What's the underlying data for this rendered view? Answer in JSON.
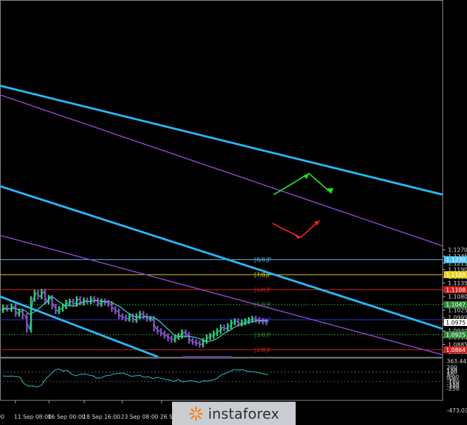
{
  "chart_data": {
    "type": "line",
    "price_panel": {
      "y_range": [
        1.0835,
        1.2285
      ],
      "y_ticks": [
        "1.1270",
        "1.1245",
        "1.1215",
        "1.1190",
        "1.1160",
        "1.1135",
        "1.1105",
        "1.1080",
        "1.1050",
        "1.1025",
        "1.0995",
        "1.0970",
        "1.0940",
        "1.0915",
        "1.0885",
        "1.0855"
      ],
      "current_price": "1.0975",
      "murray_levels": [
        {
          "label": "[8/8]P",
          "value": 1.123,
          "price_tag": "1.1230",
          "color": "#4fc3f7",
          "style": "solid"
        },
        {
          "label": "[7/8]P",
          "value": 1.1169,
          "price_tag": "1.1169",
          "color": "#e6d21e",
          "style": "solid"
        },
        {
          "label": "[6/8]P",
          "value": 1.1108,
          "price_tag": "1.1108",
          "color": "#d32020",
          "style": "solid"
        },
        {
          "label": "[5/8]P",
          "value": 1.1047,
          "price_tag": "1.1047",
          "color": "#2e8b3a",
          "style": "dotted"
        },
        {
          "label": "[4/8]P",
          "value": 1.0986,
          "price_tag": "",
          "color": "#2a3bd6",
          "style": "solid"
        },
        {
          "label": "[3/8]P",
          "value": 1.0925,
          "price_tag": "1.0925",
          "color": "#2e8b3a",
          "style": "dotted"
        },
        {
          "label": "[2/8]P",
          "value": 1.0864,
          "price_tag": "1.0864",
          "color": "#d32020",
          "style": "solid"
        }
      ]
    },
    "oscillator_panel": {
      "y_range": [
        -473.03,
        363.4436
      ],
      "y_ticks": [
        "363.4436",
        "200",
        "150",
        "100",
        "50",
        "0.00",
        "-50",
        "-100",
        "-150",
        "-200",
        "-250",
        "-473.030"
      ],
      "series": [
        20,
        10,
        15,
        5,
        -10,
        -150,
        -200,
        -190,
        -220,
        -180,
        -50,
        40,
        130,
        170,
        120,
        140,
        60,
        20,
        50,
        60,
        40,
        20,
        -30,
        -20,
        20,
        30,
        60,
        70,
        80,
        50,
        10,
        20,
        30,
        -10,
        0,
        -40,
        -10,
        -30,
        -60,
        -70,
        -100,
        -60,
        -110,
        -90,
        -80,
        -100,
        -120,
        -80,
        -90,
        -70,
        -40,
        40,
        70,
        110,
        150,
        140,
        150,
        120,
        110,
        100,
        80,
        60,
        40
      ]
    },
    "x_labels": [
      "00",
      "11 Sep 08:00",
      "16 Sep 00:00",
      "18 Sep 16:00",
      "23 Sep 08:00",
      "26 Se"
    ]
  },
  "watermark": {
    "text": "instaforex"
  }
}
